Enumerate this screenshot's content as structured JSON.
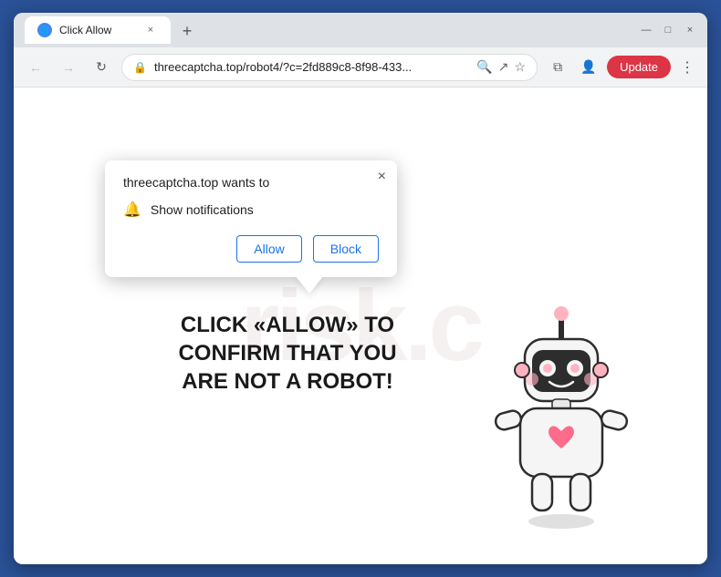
{
  "browser": {
    "tab_favicon": "🌐",
    "tab_title": "Click Allow",
    "close_tab": "×",
    "new_tab": "+",
    "nav_back": "←",
    "nav_forward": "→",
    "nav_refresh": "↻",
    "url": "threecaptcha.top/robot4/?c=2fd889c8-8f98-433...",
    "lock_icon": "🔒",
    "search_icon": "🔍",
    "share_icon": "↗",
    "bookmark_icon": "☆",
    "profile_icon": "👤",
    "split_icon": "⧉",
    "update_btn": "Update",
    "menu_icon": "⋮",
    "minimize": "—",
    "maximize": "□",
    "close_window": "×"
  },
  "popup": {
    "title": "threecaptcha.top wants to",
    "close": "×",
    "bell_icon": "🔔",
    "notification_label": "Show notifications",
    "allow_btn": "Allow",
    "block_btn": "Block"
  },
  "page": {
    "captcha_line1": "CLICK «ALLOW» TO CONFIRM THAT YOU",
    "captcha_line2": "ARE NOT A ROBOT!",
    "watermark": "risk.c"
  }
}
